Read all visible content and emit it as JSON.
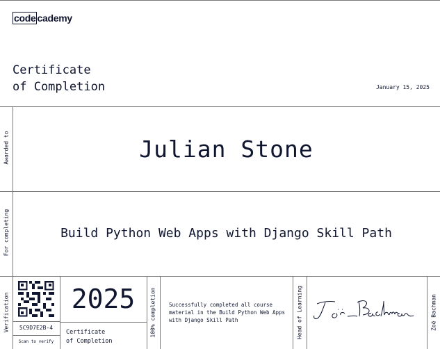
{
  "logo": {
    "part1": "code",
    "part2": "cademy"
  },
  "header": {
    "title_line1": "Certificate",
    "title_line2": "of Completion",
    "date": "January 15, 2025"
  },
  "awarded": {
    "label": "Awarded to",
    "name": "Julian Stone"
  },
  "completing": {
    "label": "For completing",
    "course": "Build Python Web Apps with Django Skill Path"
  },
  "footer": {
    "verification_label": "Verification",
    "code": "5C9D7E2B-4",
    "scan": "Scan to verify",
    "year": "2025",
    "cert_line1": "Certificate",
    "cert_line2": "of Completion",
    "completion_label": "100% completion",
    "description": "Successfully completed all course material in the Build Python Web Apps with Django Skill Path",
    "role": "Head of Learning",
    "signer": "Zoë Bachman"
  }
}
